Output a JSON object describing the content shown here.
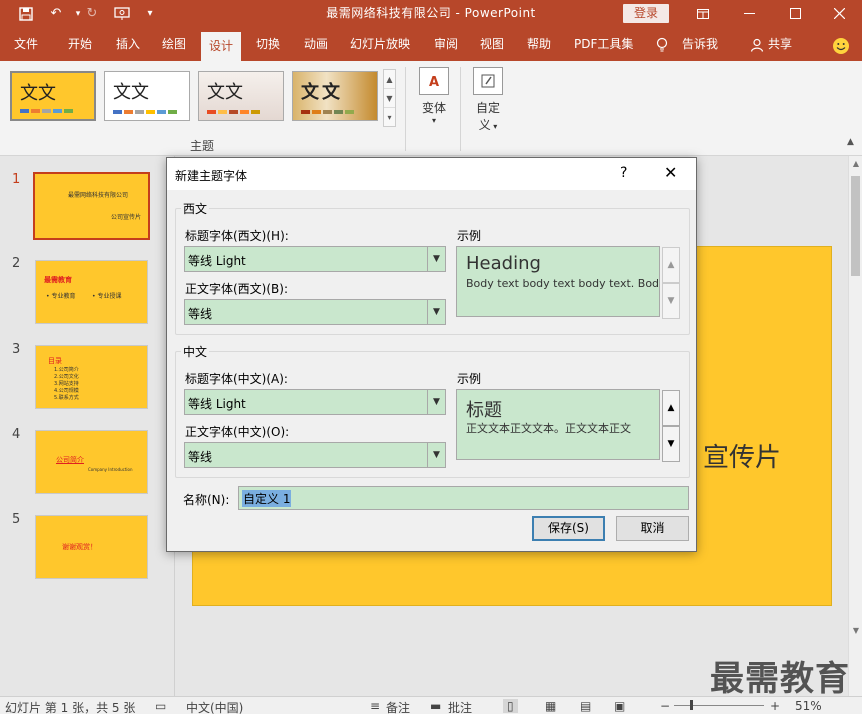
{
  "window": {
    "title": "最需网络科技有限公司 - PowerPoint",
    "login_label": "登录"
  },
  "ribbon_tabs": [
    "文件",
    "开始",
    "插入",
    "绘图",
    "设计",
    "切换",
    "动画",
    "幻灯片放映",
    "审阅",
    "视图",
    "帮助",
    "PDF工具集",
    "告诉我",
    "共享"
  ],
  "active_tab": "设计",
  "ribbon": {
    "themes_group_label": "主题",
    "theme_samples": [
      "文文",
      "文文",
      "文文",
      "文文"
    ],
    "variant_label": "变体",
    "customize_label_1": "自定",
    "customize_label_2": "义"
  },
  "slides": [
    {
      "number": "1",
      "lines": [
        "最需网络科技有限公司",
        "公司宣传片"
      ]
    },
    {
      "number": "2",
      "lines": [
        "最需教育",
        "• 专业教育",
        "• 专业授课"
      ]
    },
    {
      "number": "3",
      "lines": [
        "目录",
        "1.公司简介",
        "2.公司文化",
        "3.网站支持",
        "4.公司规模",
        "5.联系方式"
      ]
    },
    {
      "number": "4",
      "lines": [
        "公司简介",
        "Company Introduction"
      ]
    },
    {
      "number": "5",
      "lines": [
        "谢谢观赏！"
      ]
    }
  ],
  "main_slide_text": "宣传片",
  "dialog": {
    "title": "新建主题字体",
    "help": "?",
    "close": "✕",
    "western_section": "西文",
    "western_heading_label": "标题字体(西文)(H):",
    "western_heading_value": "等线 Light",
    "western_body_label": "正文字体(西文)(B):",
    "western_body_value": "等线",
    "western_preview_label": "示例",
    "western_preview_heading": "Heading",
    "western_preview_body": "Body text body text body text. Body",
    "east_section": "中文",
    "east_heading_label": "标题字体(中文)(A):",
    "east_heading_value": "等线 Light",
    "east_body_label": "正文字体(中文)(O):",
    "east_body_value": "等线",
    "east_preview_label": "示例",
    "east_preview_heading": "标题",
    "east_preview_body": "正文文本正文文本。正文文本正文",
    "name_label": "名称(N):",
    "name_value": "自定义 1",
    "save_label": "保存(S)",
    "cancel_label": "取消"
  },
  "status_bar": {
    "slide_info": "幻灯片 第 1 张，共 5 张",
    "language": "中文(中国)",
    "notes": "备注",
    "comments": "批注",
    "zoom": "51%"
  },
  "watermark": "最需教育",
  "colors": {
    "accent": "#b7472a",
    "slide_bg": "#ffc72c",
    "field_bg": "#c9e7cd"
  }
}
